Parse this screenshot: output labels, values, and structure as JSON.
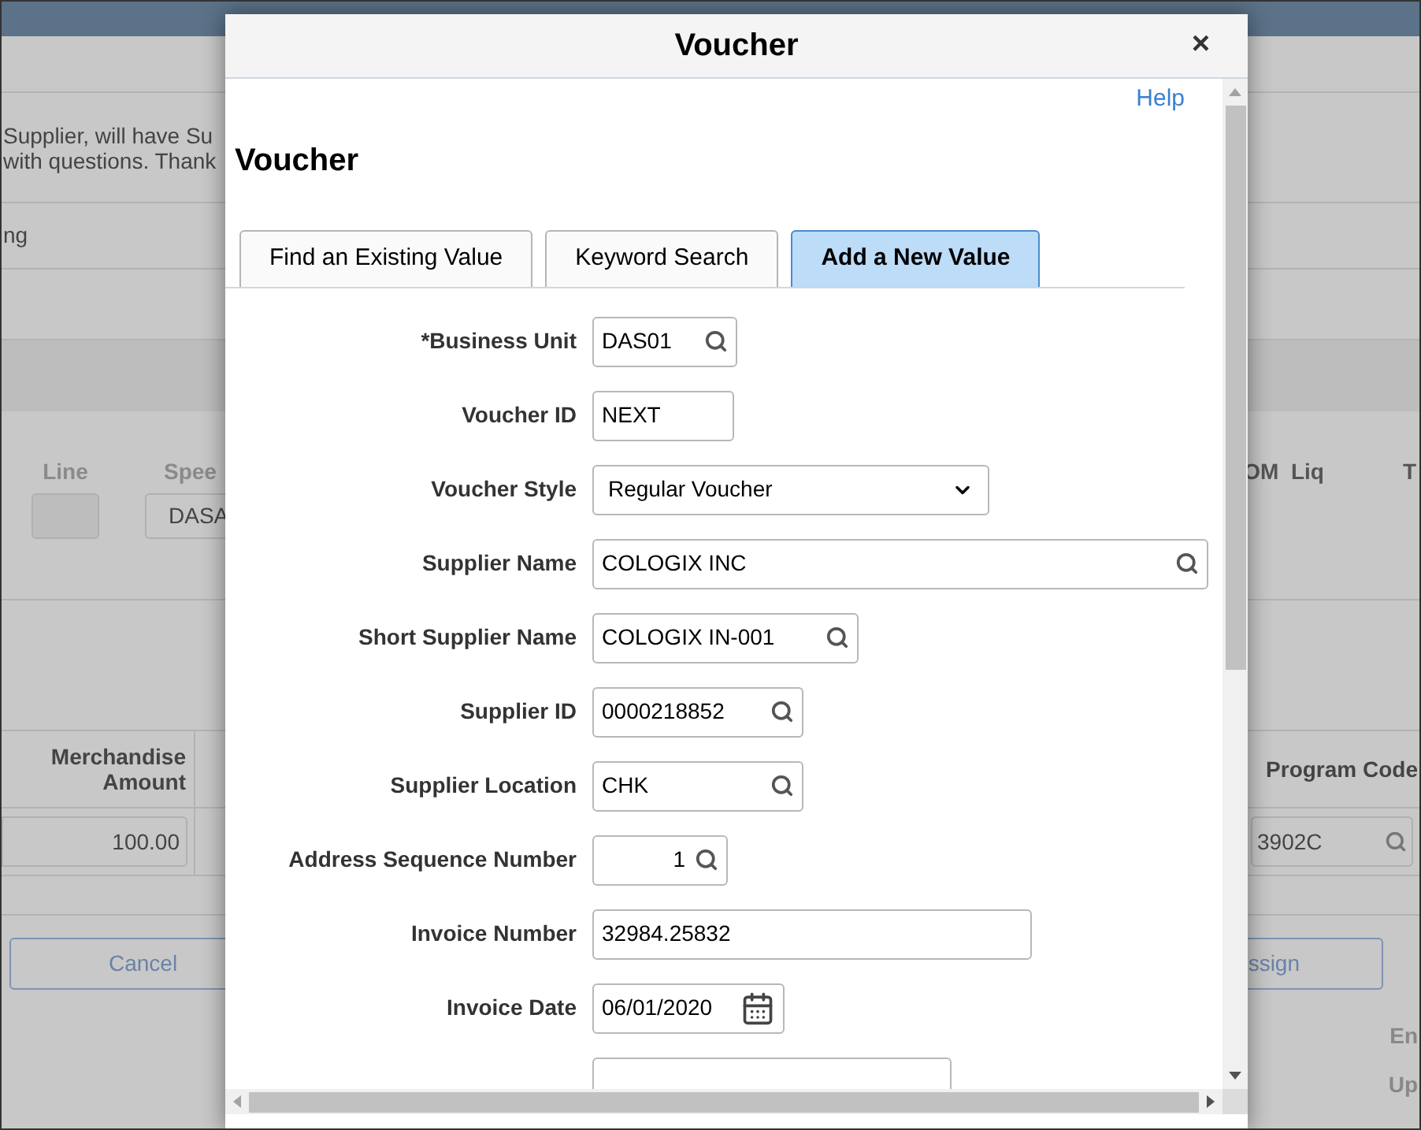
{
  "background": {
    "message_lines": [
      "Supplier, will have Su",
      "with questions. Thank"
    ],
    "status_text": "ng",
    "line_label": "Line",
    "speed_label": "Spee",
    "speed_value": "DASA",
    "om_liq_label": "OM  Liq",
    "t_label": "T",
    "merch_header": "Merchandise Amount",
    "merch_value": "100.00",
    "program_header": "Program Code",
    "program_value": "3902C",
    "cancel_button": "Cancel",
    "assign_button": "ssign",
    "side_labels": [
      "En",
      "Up"
    ]
  },
  "dialog": {
    "title": "Voucher",
    "close": "×",
    "help": "Help",
    "heading": "Voucher",
    "tabs": [
      {
        "label": "Find an Existing Value",
        "selected": false
      },
      {
        "label": "Keyword Search",
        "selected": false
      },
      {
        "label": "Add a New Value",
        "selected": true
      }
    ],
    "fields": [
      {
        "label": "*Business Unit",
        "kind": "prompt",
        "value": "DAS01"
      },
      {
        "label": "Voucher ID",
        "kind": "text",
        "value": "NEXT"
      },
      {
        "label": "Voucher Style",
        "kind": "select",
        "value": "Regular Voucher"
      },
      {
        "label": "Supplier Name",
        "kind": "prompt",
        "value": "COLOGIX INC"
      },
      {
        "label": "Short Supplier Name",
        "kind": "prompt",
        "value": "COLOGIX IN-001"
      },
      {
        "label": "Supplier ID",
        "kind": "prompt",
        "value": "0000218852"
      },
      {
        "label": "Supplier Location",
        "kind": "prompt",
        "value": "CHK"
      },
      {
        "label": "Address Sequence Number",
        "kind": "number_prompt",
        "value": "1"
      },
      {
        "label": "Invoice Number",
        "kind": "text",
        "value": "32984.25832"
      },
      {
        "label": "Invoice Date",
        "kind": "date",
        "value": "06/01/2020"
      }
    ]
  }
}
